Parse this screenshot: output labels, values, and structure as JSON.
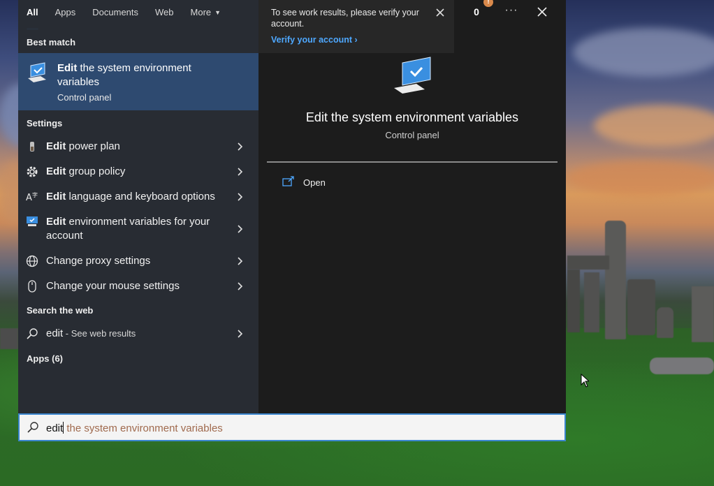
{
  "tabs": [
    {
      "label": "All",
      "active": true
    },
    {
      "label": "Apps",
      "active": false
    },
    {
      "label": "Documents",
      "active": false
    },
    {
      "label": "Web",
      "active": false
    },
    {
      "label": "More",
      "active": false
    }
  ],
  "sections": {
    "best_match": "Best match",
    "settings": "Settings",
    "search_web": "Search the web",
    "apps": "Apps (6)"
  },
  "best_match": {
    "title_bold": "Edit",
    "title_rest": " the system environment variables",
    "subtitle": "Control panel",
    "icon": "monitor-check-icon"
  },
  "settings_items": [
    {
      "bold": "Edit",
      "rest": " power plan",
      "icon": "battery-icon"
    },
    {
      "bold": "Edit",
      "rest": " group policy",
      "icon": "gear-icon"
    },
    {
      "bold": "Edit",
      "rest": " language and keyboard options",
      "icon": "language-icon"
    },
    {
      "bold": "Edit",
      "rest": " environment variables for your account",
      "icon": "monitor-check-icon"
    },
    {
      "bold": "",
      "rest": "Change proxy settings",
      "icon": "globe-icon"
    },
    {
      "bold": "",
      "rest": "Change your mouse settings",
      "icon": "mouse-icon"
    }
  ],
  "web_result": {
    "query": "edit",
    "suffix": " - See web results",
    "icon": "search-icon"
  },
  "notice": {
    "text": "To see work results, please verify your account.",
    "link": "Verify your account"
  },
  "rewards": {
    "points": "0",
    "badge": "!"
  },
  "more_label": "···",
  "preview": {
    "title": "Edit the system environment variables",
    "subtitle": "Control panel",
    "action": "Open"
  },
  "search": {
    "typed": "edit",
    "suggestion": " the system environment variables"
  },
  "colors": {
    "accent": "#4aa0ef",
    "selection": "#2e4a70",
    "link": "#4ea8ff",
    "badge": "#d9894b"
  }
}
